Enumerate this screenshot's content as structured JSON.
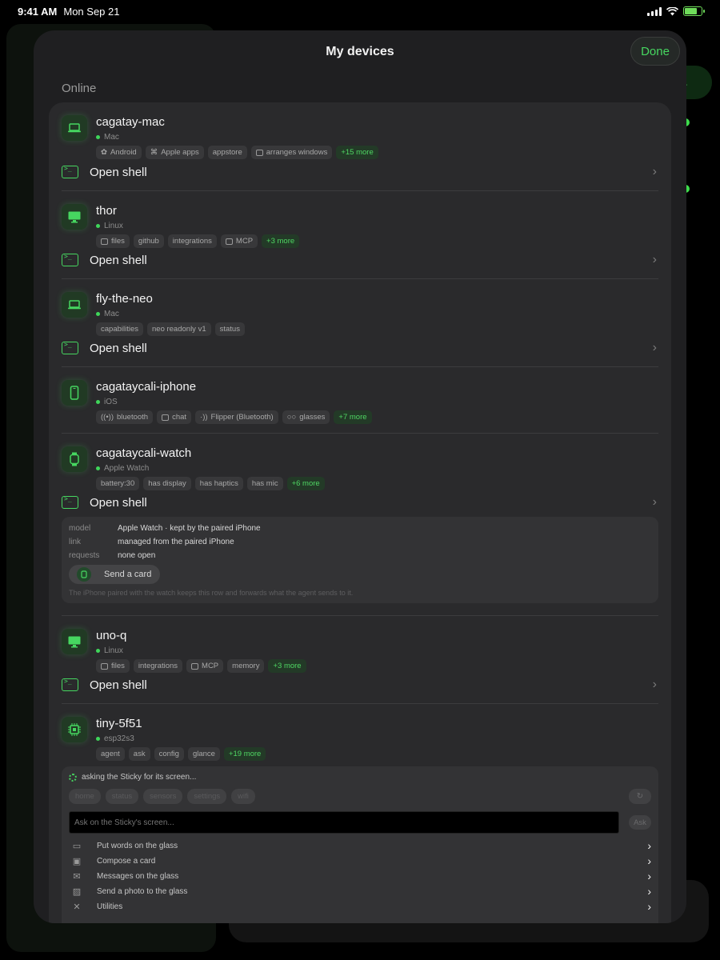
{
  "status_bar": {
    "time": "9:41 AM",
    "date": "Mon Sep 21"
  },
  "background": {
    "pill_text": "nt."
  },
  "sheet": {
    "title": "My devices",
    "done_label": "Done",
    "section_label": "Online"
  },
  "devices": [
    {
      "name": "cagatay-mac",
      "platform": "Mac",
      "icon": "laptop-icon",
      "tags": [
        {
          "label": "Android",
          "icon": "android-icon"
        },
        {
          "label": "Apple apps",
          "icon": "command-icon"
        },
        {
          "label": "appstore",
          "icon": ""
        },
        {
          "label": "arranges windows",
          "icon": "windows-icon"
        }
      ],
      "more": "+15 more",
      "shell_label": "Open shell"
    },
    {
      "name": "thor",
      "platform": "Linux",
      "icon": "monitor-icon",
      "tags": [
        {
          "label": "files",
          "icon": "folder-icon"
        },
        {
          "label": "github",
          "icon": ""
        },
        {
          "label": "integrations",
          "icon": ""
        },
        {
          "label": "MCP",
          "icon": "plug-icon"
        }
      ],
      "more": "+3 more",
      "shell_label": "Open shell"
    },
    {
      "name": "fly-the-neo",
      "platform": "Mac",
      "icon": "laptop-icon",
      "tags": [
        {
          "label": "capabilities",
          "icon": ""
        },
        {
          "label": "neo readonly v1",
          "icon": ""
        },
        {
          "label": "status",
          "icon": ""
        }
      ],
      "more": "",
      "shell_label": "Open shell"
    },
    {
      "name": "cagataycali-iphone",
      "platform": "iOS",
      "icon": "phone-icon",
      "tags": [
        {
          "label": "bluetooth",
          "icon": "broadcast-icon"
        },
        {
          "label": "chat",
          "icon": "chat-icon"
        },
        {
          "label": "Flipper (Bluetooth)",
          "icon": "signal-icon"
        },
        {
          "label": "glasses",
          "icon": "glasses-icon"
        }
      ],
      "more": "+7 more",
      "shell_label": ""
    },
    {
      "name": "cagataycali-watch",
      "platform": "Apple Watch",
      "icon": "watch-icon",
      "tags": [
        {
          "label": "battery:30",
          "icon": ""
        },
        {
          "label": "has display",
          "icon": ""
        },
        {
          "label": "has haptics",
          "icon": ""
        },
        {
          "label": "has mic",
          "icon": ""
        }
      ],
      "more": "+6 more",
      "shell_label": "Open shell"
    },
    {
      "name": "uno-q",
      "platform": "Linux",
      "icon": "monitor-icon",
      "tags": [
        {
          "label": "files",
          "icon": "folder-icon"
        },
        {
          "label": "integrations",
          "icon": ""
        },
        {
          "label": "MCP",
          "icon": "plug-icon"
        },
        {
          "label": "memory",
          "icon": ""
        }
      ],
      "more": "+3 more",
      "shell_label": "Open shell"
    },
    {
      "name": "tiny-5f51",
      "platform": "esp32s3",
      "icon": "chip-icon",
      "tags": [
        {
          "label": "agent",
          "icon": ""
        },
        {
          "label": "ask",
          "icon": ""
        },
        {
          "label": "config",
          "icon": ""
        },
        {
          "label": "glance",
          "icon": ""
        }
      ],
      "more": "+19 more",
      "shell_label": ""
    }
  ],
  "watch_panel": {
    "rows": [
      {
        "key": "model",
        "value": "Apple Watch · kept by the paired iPhone"
      },
      {
        "key": "link",
        "value": "managed from the paired iPhone"
      },
      {
        "key": "requests",
        "value": "none open"
      }
    ],
    "send_card_label": "Send a card",
    "note": "The iPhone paired with the watch keeps this row and forwards what the agent sends to it."
  },
  "sticky_panel": {
    "status": "asking the Sticky for its screen...",
    "chips": [
      "home",
      "status",
      "sensors",
      "settings",
      "wifi"
    ],
    "input_placeholder": "Ask on the Sticky's screen...",
    "ask_label": "Ask",
    "actions": [
      {
        "label": "Put words on the glass",
        "icon": "chat-icon"
      },
      {
        "label": "Compose a card",
        "icon": "layout-icon"
      },
      {
        "label": "Messages on the glass",
        "icon": "mail-icon"
      },
      {
        "label": "Send a photo to the glass",
        "icon": "photo-icon"
      },
      {
        "label": "Utilities",
        "icon": "tools-icon"
      }
    ]
  },
  "colors": {
    "accent": "#46d760",
    "sheet_bg": "#1f1f21",
    "card_bg": "#2a2a2c",
    "tag_bg": "#38383a"
  }
}
